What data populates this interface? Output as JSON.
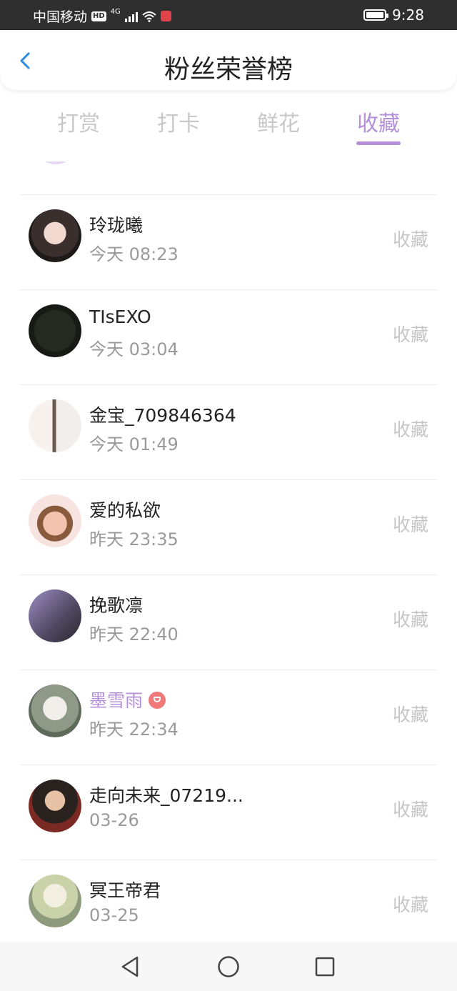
{
  "status_bar": {
    "carrier": "中国移动",
    "hd": "HD",
    "network": "4G",
    "time": "9:28"
  },
  "header": {
    "title": "粉丝荣誉榜"
  },
  "tabs": [
    {
      "label": "打赏",
      "active": false
    },
    {
      "label": "打卡",
      "active": false
    },
    {
      "label": "鲜花",
      "active": false
    },
    {
      "label": "收藏",
      "active": true
    }
  ],
  "list": [
    {
      "name": "玲珑曦",
      "time": "今天 08:23",
      "action": "收藏",
      "vip": false
    },
    {
      "name": "TIsEXO",
      "time": "今天 03:04",
      "action": "收藏",
      "vip": false
    },
    {
      "name": "金宝_709846364",
      "time": "今天 01:49",
      "action": "收藏",
      "vip": false
    },
    {
      "name": "爱的私欲",
      "time": "昨天 23:35",
      "action": "收藏",
      "vip": false
    },
    {
      "name": "挽歌凛",
      "time": "昨天 22:40",
      "action": "收藏",
      "vip": false
    },
    {
      "name": "墨雪雨",
      "time": "昨天 22:34",
      "action": "收藏",
      "vip": true
    },
    {
      "name": "走向未来_07219...",
      "time": "03-26",
      "action": "收藏",
      "vip": false
    },
    {
      "name": "冥王帝君",
      "time": "03-25",
      "action": "收藏",
      "vip": false
    }
  ],
  "colors": {
    "accent": "#b58fd8",
    "back_arrow": "#2a8be0",
    "inactive_tab": "#c8c8c8",
    "vip_badge": "#f07a7a"
  }
}
